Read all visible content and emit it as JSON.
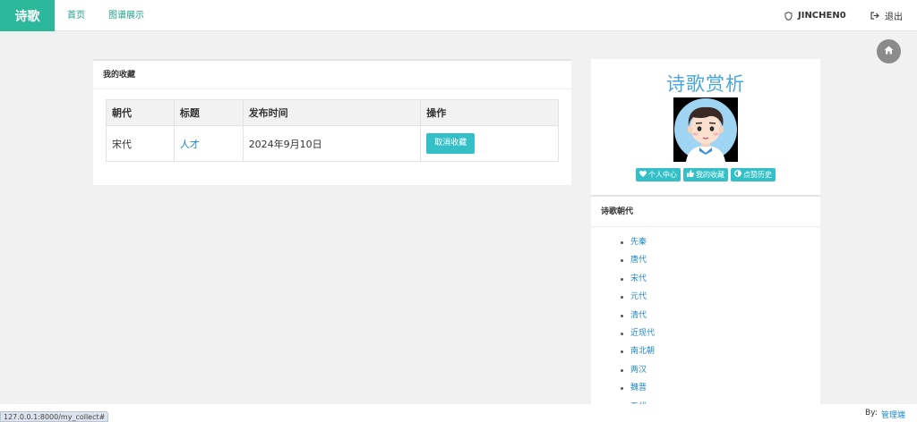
{
  "nav": {
    "brand": "诗歌",
    "links": [
      {
        "label": "首页"
      },
      {
        "label": "图谱展示"
      }
    ],
    "username": "JINCHEN0",
    "logout": "退出"
  },
  "favorites": {
    "header": "我的收藏",
    "columns": [
      "朝代",
      "标题",
      "发布时间",
      "操作"
    ],
    "rows": [
      {
        "dynasty": "宋代",
        "title": "人才",
        "date": "2024年9月10日",
        "action": "取消收藏"
      }
    ]
  },
  "profile": {
    "site_title": "诗歌赏析",
    "buttons": [
      {
        "label": "个人中心",
        "icon": "heart-icon"
      },
      {
        "label": "我的收藏",
        "icon": "thumbs-up-icon"
      },
      {
        "label": "点赞历史",
        "icon": "adjust-icon"
      }
    ]
  },
  "dynasties": {
    "header": "诗歌朝代",
    "items": [
      "先秦",
      "唐代",
      "宋代",
      "元代",
      "清代",
      "近现代",
      "南北朝",
      "两汉",
      "魏晋",
      "五代"
    ]
  },
  "footer": {
    "by_label": "By:",
    "admin_link": "管理端"
  },
  "status_bar": {
    "url": "127.0.0.1:8000/my_collect#"
  },
  "colors": {
    "brand": "#2bb89a",
    "accent": "#34c0c6",
    "link": "#1e88c7",
    "title": "#4aa6d9"
  }
}
